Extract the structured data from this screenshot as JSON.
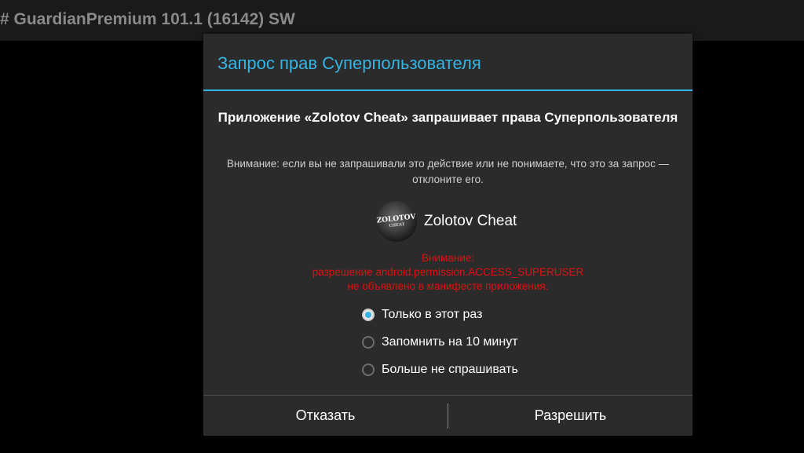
{
  "statusbar": {
    "title": "# GuardianPremium 101.1 (16142) SW"
  },
  "dialog": {
    "title": "Запрос прав Суперпользователя",
    "request_heading": "Приложение «Zolotov Cheat» запрашивает права Суперпользователя",
    "warning": "Внимание: если вы не запрашивали это действие или не понимаете, что это за запрос — отклоните его.",
    "app": {
      "name": "Zolotov Cheat",
      "icon": "zolotov-app-icon"
    },
    "manifest_warning": {
      "line1": "Внимание:",
      "line2": "разрешение android.permission.ACCESS_SUPERUSER",
      "line3": "не объявлено в манифесте приложения."
    },
    "options": [
      {
        "label": "Только в этот раз",
        "checked": true
      },
      {
        "label": "Запомнить на 10 минут",
        "checked": false
      },
      {
        "label": "Больше не спрашивать",
        "checked": false
      }
    ],
    "buttons": {
      "deny": "Отказать",
      "allow": "Разрешить"
    }
  },
  "colors": {
    "accent": "#33b5e5",
    "warning": "#e01010",
    "dialog_bg": "#2b2b2b"
  }
}
